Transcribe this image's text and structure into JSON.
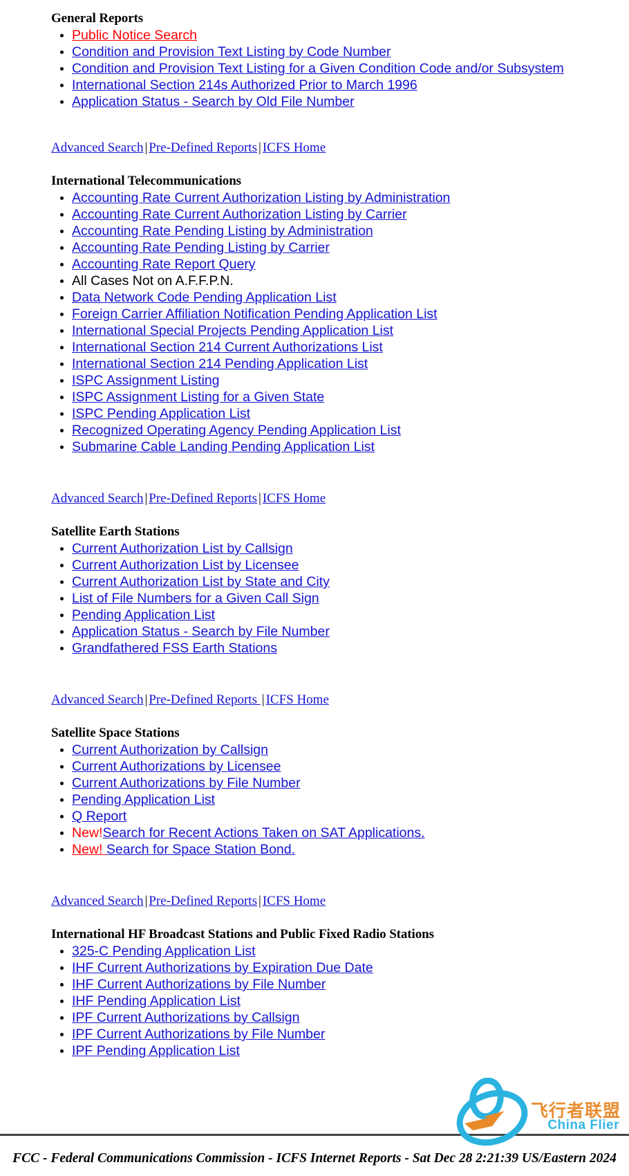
{
  "nav": {
    "advanced_search": "Advanced Search",
    "pre_defined_reports": "Pre-Defined Reports",
    "pre_defined_reports_trailing": "Pre-Defined Reports ",
    "icfs_home": "ICFS Home",
    "separator": "|"
  },
  "sections": [
    {
      "title": "General Reports",
      "items": [
        {
          "label": "Public Notice Search",
          "type": "link",
          "color": "#ff0000"
        },
        {
          "label": "Condition and Provision Text Listing by Code Number",
          "type": "link"
        },
        {
          "label": "Condition and Provision Text Listing for a Given Condition Code and/or Subsystem",
          "type": "link"
        },
        {
          "label": "International Section 214s Authorized Prior to March 1996",
          "type": "link"
        },
        {
          "label": "Application Status - Search by Old File Number",
          "type": "link"
        }
      ]
    },
    {
      "title": "International Telecommunications",
      "items": [
        {
          "label": "Accounting Rate Current Authorization Listing by Administration",
          "type": "link"
        },
        {
          "label": "Accounting Rate Current Authorization Listing by Carrier",
          "type": "link"
        },
        {
          "label": "Accounting Rate Pending Listing by Administration",
          "type": "link"
        },
        {
          "label": "Accounting Rate Pending Listing by Carrier",
          "type": "link"
        },
        {
          "label": "Accounting Rate Report Query",
          "type": "link"
        },
        {
          "label": "All Cases Not on A.F.F.P.N.",
          "type": "text"
        },
        {
          "label": "Data Network Code Pending Application List",
          "type": "link"
        },
        {
          "label": "Foreign Carrier Affiliation Notification Pending Application List",
          "type": "link"
        },
        {
          "label": "International Special Projects Pending Application List",
          "type": "link"
        },
        {
          "label": "International Section 214 Current Authorizations List",
          "type": "link"
        },
        {
          "label": "International Section 214 Pending Application List",
          "type": "link"
        },
        {
          "label": "ISPC Assignment Listing",
          "type": "link"
        },
        {
          "label": "ISPC Assignment Listing for a Given State",
          "type": "link"
        },
        {
          "label": "ISPC Pending Application List",
          "type": "link"
        },
        {
          "label": "Recognized Operating Agency Pending Application List",
          "type": "link"
        },
        {
          "label": "Submarine Cable Landing Pending Application List",
          "type": "link"
        }
      ]
    },
    {
      "title": "Satellite Earth Stations",
      "items": [
        {
          "label": "Current Authorization List by Callsign",
          "type": "link"
        },
        {
          "label": "Current Authorization List by Licensee",
          "type": "link"
        },
        {
          "label": "Current Authorization List by State and City",
          "type": "link"
        },
        {
          "label": "List of File Numbers for a Given Call Sign",
          "type": "link"
        },
        {
          "label": "Pending Application List",
          "type": "link"
        },
        {
          "label": "Application Status - Search by File Number",
          "type": "link"
        },
        {
          "label": "Grandfathered FSS Earth Stations",
          "type": "link"
        }
      ]
    },
    {
      "title": "Satellite Space Stations",
      "items": [
        {
          "label": "Current Authorization by Callsign",
          "type": "link"
        },
        {
          "label": "Current Authorizations by Licensee",
          "type": "link"
        },
        {
          "label": "Current Authorizations by File Number",
          "type": "link"
        },
        {
          "label": "Pending Application List",
          "type": "link"
        },
        {
          "label": "Q Report",
          "type": "link"
        },
        {
          "label": "Search for Recent Actions Taken on SAT Applications.",
          "type": "link",
          "badge": "New!",
          "badge_underlined": false
        },
        {
          "label": "Search for Space Station Bond.",
          "type": "link",
          "badge": "New! ",
          "badge_underlined": true
        }
      ]
    },
    {
      "title": "International HF Broadcast Stations and Public Fixed Radio Stations",
      "items": [
        {
          "label": "325-C Pending Application List",
          "type": "link"
        },
        {
          "label": "IHF Current Authorizations by Expiration Due Date",
          "type": "link"
        },
        {
          "label": "IHF Current Authorizations by File Number",
          "type": "link"
        },
        {
          "label": "IHF Pending Application List",
          "type": "link"
        },
        {
          "label": "IPF Current Authorizations by Callsign",
          "type": "link"
        },
        {
          "label": "IPF Current Authorizations by File Number",
          "type": "link"
        },
        {
          "label": "IPF Pending Application List",
          "type": "link"
        }
      ]
    }
  ],
  "footer": {
    "text": "FCC - Federal Communications Commission - ICFS Internet Reports - Sat Dec 28 2:21:39 US/Eastern 2024"
  },
  "watermark": {
    "main_text": "飞行者联盟",
    "sub_text": "China Flier",
    "logo_color": "#2bb3e0",
    "accent_color": "#e8892a"
  },
  "colors": {
    "link": "#1414d2",
    "link_red": "#ff0000",
    "text": "#000000",
    "background": "#ffffff"
  }
}
